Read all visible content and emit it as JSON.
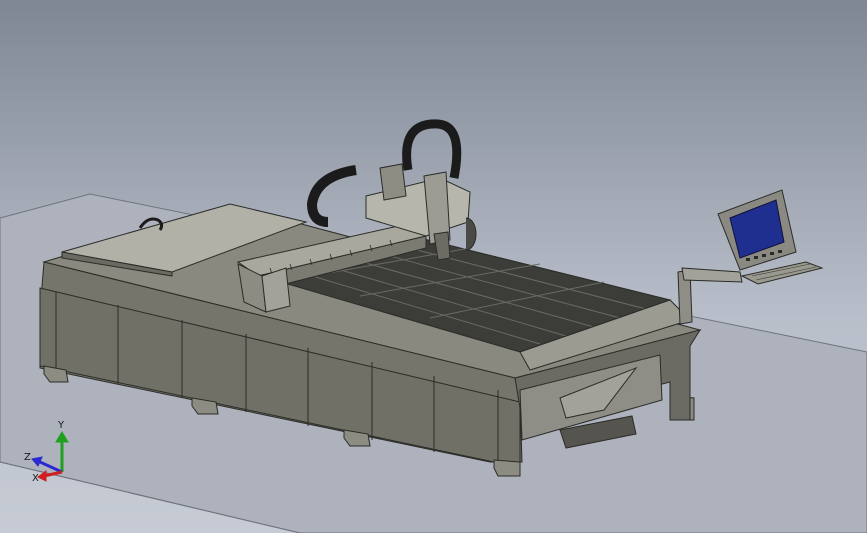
{
  "viewport": {
    "background_top": "#7f8794",
    "background_bottom": "#c6cbd4"
  },
  "model": {
    "frame_color": "#74736a",
    "frame_dark": "#5b5a53",
    "line_color": "#2b2b28",
    "bed_color": "#3c3c39",
    "screen_color": "#1f2f8f"
  },
  "triad": {
    "y_label": "Y",
    "z_label": "Z",
    "x_label": "X",
    "y_color": "#1fa01f",
    "x_color": "#d01f1f",
    "z_color": "#2a2ad0"
  }
}
